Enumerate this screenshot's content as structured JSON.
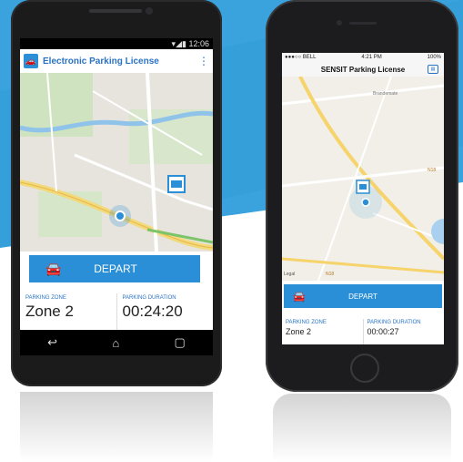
{
  "colors": {
    "accent": "#2a8fd6",
    "title_blue": "#2a73c4"
  },
  "android": {
    "status_time": "12:06",
    "app_title": "Electronic Parking License",
    "menu_icon": "more-vertical-icon",
    "depart_label": "DEPART",
    "zone_label": "PARKING ZONE",
    "zone_value": "Zone 2",
    "duration_label": "PARKING DURATION",
    "duration_value": "00:24:20",
    "nav": {
      "back": "↩",
      "home": "⌂",
      "recent": "▢"
    }
  },
  "iphone": {
    "carrier": "●●●○○ BELL",
    "time": "4:21 PM",
    "battery": "100%",
    "app_title": "SENSIT Parking License",
    "depart_label": "DEPART",
    "zone_label": "PARKING ZONE",
    "zone_value": "Zone 2",
    "duration_label": "PARKING DURATION",
    "duration_value": "00:00:27",
    "map_labels": [
      "Brandemate",
      "N18",
      "N18",
      "Legal"
    ]
  }
}
